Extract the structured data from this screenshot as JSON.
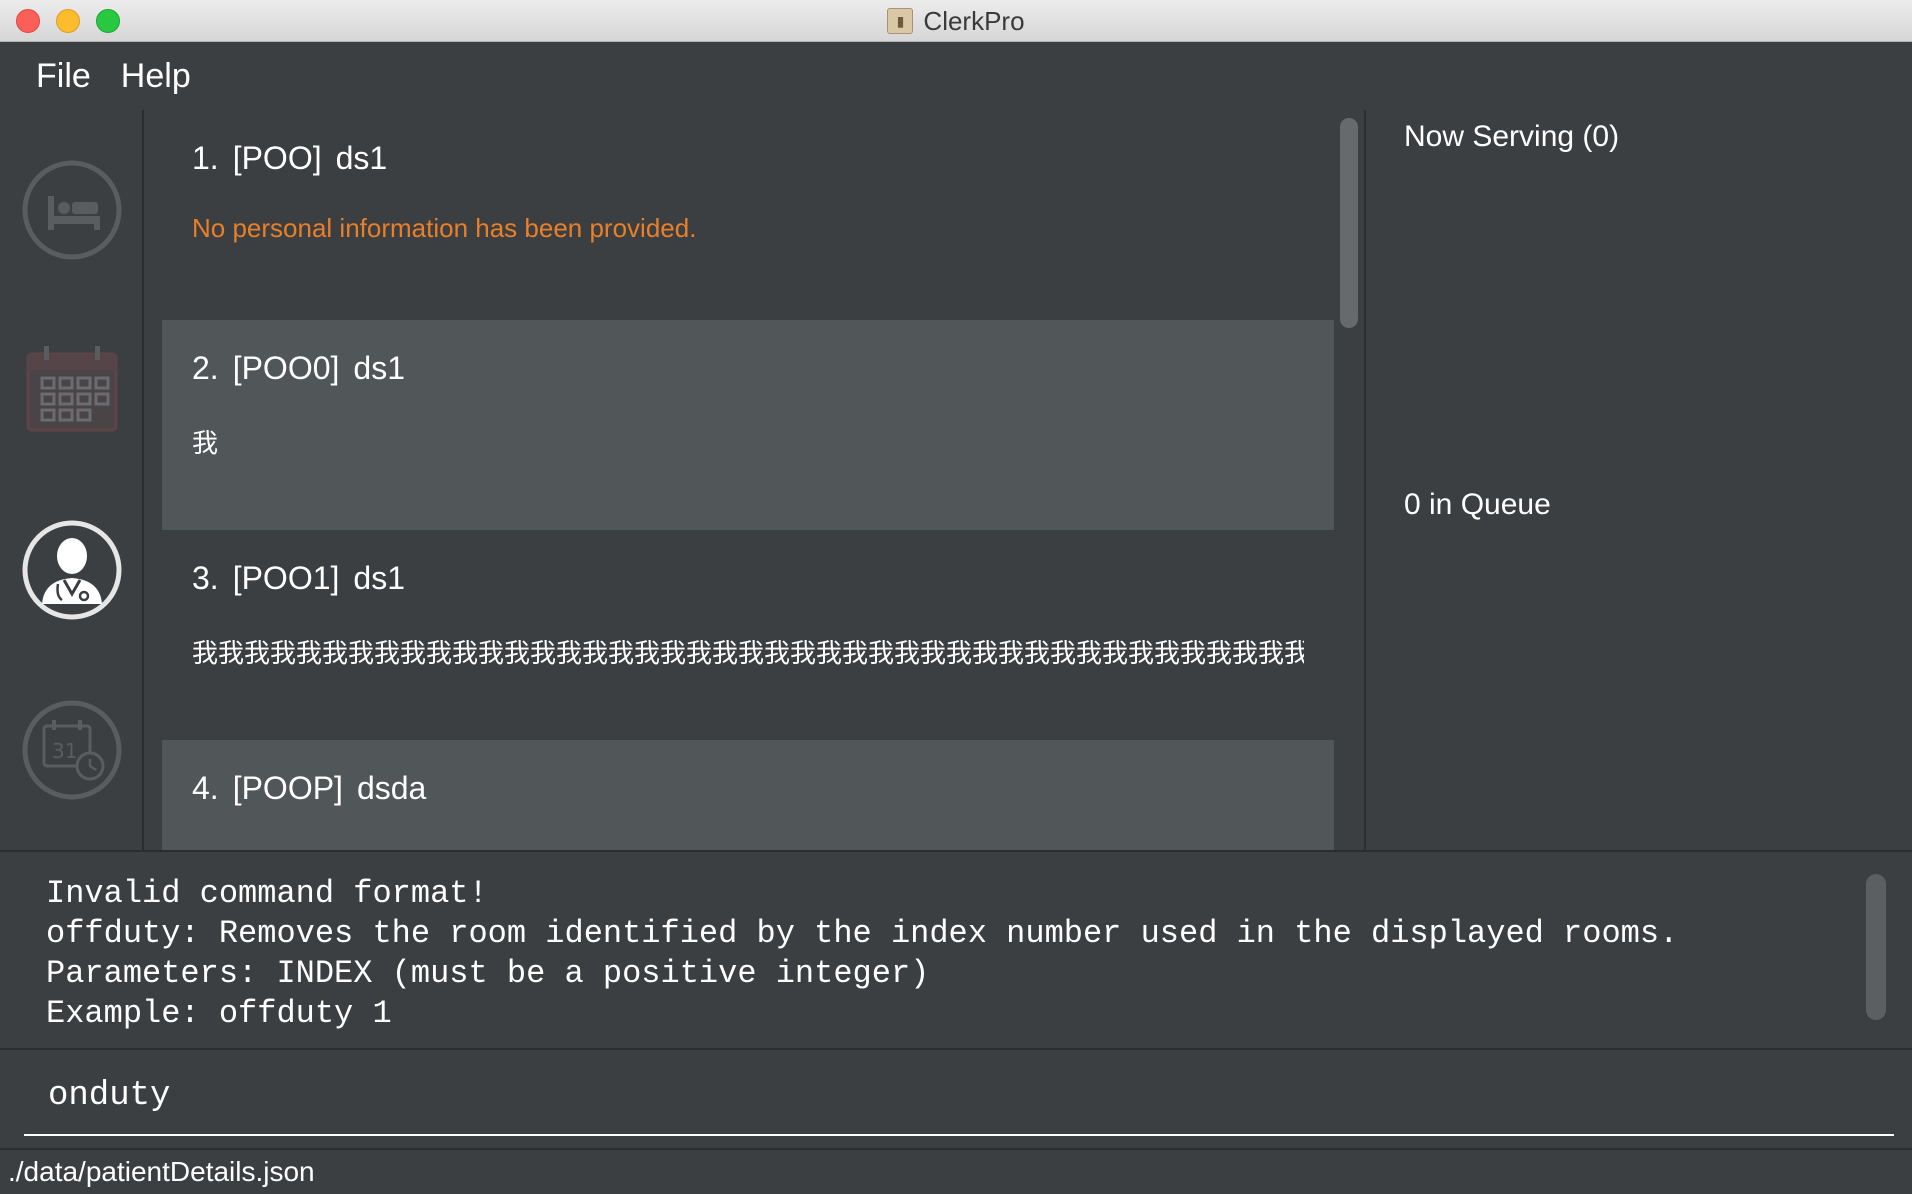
{
  "window": {
    "title": "ClerkPro",
    "app_icon": "contact-book-icon"
  },
  "menu": {
    "items": [
      "File",
      "Help"
    ]
  },
  "sidebar": {
    "items": [
      {
        "name": "room-bed-icon",
        "active": false
      },
      {
        "name": "calendar-grid-icon",
        "active": false
      },
      {
        "name": "doctor-icon",
        "active": true
      },
      {
        "name": "appointment-clock-icon",
        "active": false
      }
    ]
  },
  "patients": [
    {
      "index": "1.",
      "ref": "[POO]",
      "name": "ds1",
      "detail": "No personal information has been provided.",
      "detail_style": "warning"
    },
    {
      "index": "2.",
      "ref": "[POO0]",
      "name": "ds1",
      "detail": "我",
      "detail_style": "normal"
    },
    {
      "index": "3.",
      "ref": "[POO1]",
      "name": "ds1",
      "detail": "我我我我我我我我我我我我我我我我我我我我我我我我我我我我我我我我我我我我我我我我我我我…",
      "detail_style": "normal"
    },
    {
      "index": "4.",
      "ref": "[POOP]",
      "name": "dsda",
      "detail": "",
      "detail_style": "normal"
    }
  ],
  "queue": {
    "now_serving": "Now Serving (0)",
    "in_queue": "0 in Queue"
  },
  "result": {
    "text": "Invalid command format! \noffduty: Removes the room identified by the index number used in the displayed rooms.\nParameters: INDEX (must be a positive integer)\nExample: offduty 1"
  },
  "command": {
    "value": "onduty"
  },
  "status": {
    "path": "./data/patientDetails.json"
  },
  "colors": {
    "background": "#3c3f41",
    "card_light": "#515658",
    "warning_text": "#e87f2a"
  }
}
